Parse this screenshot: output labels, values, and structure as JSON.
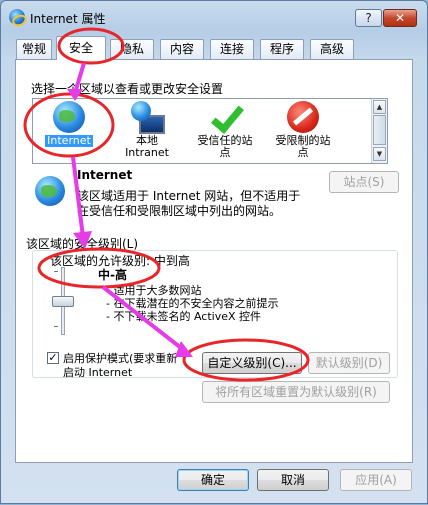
{
  "window": {
    "title": "Internet 属性",
    "help_label": "?",
    "close_label": "✕"
  },
  "tabs": [
    "常规",
    "安全",
    "隐私",
    "内容",
    "连接",
    "程序",
    "高级"
  ],
  "active_tab": "安全",
  "security": {
    "zone_prompt": "选择一个区域以查看或更改安全设置",
    "zones": [
      {
        "label": "Internet",
        "icon": "internet-globe-icon",
        "selected": true
      },
      {
        "label": "本地\nIntranet",
        "icon": "intranet-icon",
        "selected": false
      },
      {
        "label": "受信任的站\n点",
        "icon": "trusted-sites-check-icon",
        "selected": false
      },
      {
        "label": "受限制的站\n点",
        "icon": "restricted-sites-icon",
        "selected": false
      }
    ],
    "zone_title": "Internet",
    "zone_desc_1": "该区域适用于 Internet 网站，但不适用于",
    "zone_desc_2": "在受信任和受限制区域中列出的网站。",
    "sites_button": "站点(S)",
    "level_group_label": "该区域的安全级别(L)",
    "allowed_levels_text": "该区域的允许级别: 中到高",
    "level_name": "中-高",
    "level_bullets": [
      "- 适用于大多数网站",
      "- 在下载潜在的不安全内容之前提示",
      "- 不下载未签名的 ActiveX 控件"
    ],
    "protected_mode_label_1": "启用保护模式(要求重新",
    "protected_mode_label_2": "启动 Internet",
    "protected_mode_checked": true,
    "custom_level_button": "自定义级别(C)...",
    "default_level_button": "默认级别(D)",
    "reset_all_button": "将所有区域重置为默认级别(R)"
  },
  "footer": {
    "ok": "确定",
    "cancel": "取消",
    "apply": "应用(A)"
  },
  "colors": {
    "annotation_red": "#e8262a",
    "annotation_magenta": "#e63be8",
    "selection_blue": "#3399ff"
  }
}
